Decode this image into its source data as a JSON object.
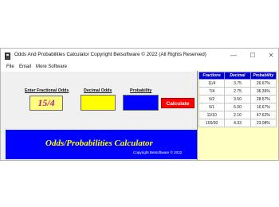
{
  "window": {
    "title": "Odds And Probabilities Calculator Copyright Betsoftware © 2022 (All Rights Reserved)",
    "minimize": "—",
    "maximize": "☐",
    "close": "✕"
  },
  "menu": [
    "File",
    "Email",
    "More Software"
  ],
  "form": {
    "fraction_label": "Enter Fractional Odds",
    "fraction_value": "15/4",
    "decimal_label": "Decimal Odds",
    "decimal_value": "",
    "probability_label": "Probability",
    "probability_value": "",
    "calculate_label": "Calculate"
  },
  "banner": {
    "title": "Odds/Probabilities Calculator",
    "copyright": "Copyright  Betsoftware © 2022"
  },
  "table": {
    "headers": [
      "Fractions",
      "Decimal",
      "Probability"
    ],
    "rows": [
      [
        "11/4",
        "3.75",
        "26.67%"
      ],
      [
        "7/4",
        "2.75",
        "36.36%"
      ],
      [
        "5/2",
        "3.50",
        "28.57%"
      ],
      [
        "5/1",
        "6.00",
        "16.67%"
      ],
      [
        "11/10",
        "2.10",
        "47.62%"
      ],
      [
        "100/30",
        "4.33",
        "23.08%"
      ]
    ]
  },
  "colors": {
    "banner": "#0000ff",
    "banner_title": "#ffff00",
    "calculate_button": "#ff0000",
    "decimal_box": "#ffff00",
    "probability_box": "#0000ff",
    "table_header": "#0000cc",
    "table_panel": "#ffffc4"
  }
}
